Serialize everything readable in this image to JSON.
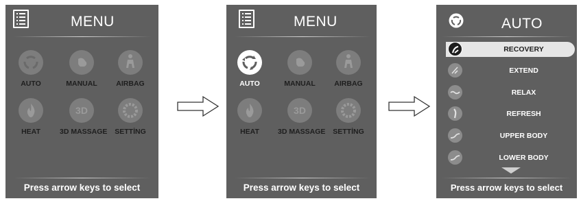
{
  "screens": [
    {
      "title": "MENU",
      "items": [
        {
          "label": "AUTO",
          "icon": "auto-cycle-icon"
        },
        {
          "label": "MANUAL",
          "icon": "hand-icon"
        },
        {
          "label": "AIRBAG",
          "icon": "body-airbag-icon"
        },
        {
          "label": "HEAT",
          "icon": "flame-icon"
        },
        {
          "label": "3D MASSAGE",
          "icon": "3d-icon"
        },
        {
          "label": "SETTİNG",
          "icon": "gear-icon"
        }
      ],
      "selected": null,
      "footer": "Press arrow keys to select"
    },
    {
      "title": "MENU",
      "items": [
        {
          "label": "AUTO",
          "icon": "auto-cycle-icon"
        },
        {
          "label": "MANUAL",
          "icon": "hand-icon"
        },
        {
          "label": "AIRBAG",
          "icon": "body-airbag-icon"
        },
        {
          "label": "HEAT",
          "icon": "flame-icon"
        },
        {
          "label": "3D MASSAGE",
          "icon": "3d-icon"
        },
        {
          "label": "SETTİNG",
          "icon": "gear-icon"
        }
      ],
      "selected": "AUTO",
      "footer": "Press arrow keys to select"
    },
    {
      "title": "AUTO",
      "programs": [
        {
          "label": "RECOVERY",
          "icon": "recovery-icon"
        },
        {
          "label": "EXTEND",
          "icon": "extend-icon"
        },
        {
          "label": "RELAX",
          "icon": "relax-icon"
        },
        {
          "label": "REFRESH",
          "icon": "refresh-icon"
        },
        {
          "label": "UPPER BODY",
          "icon": "upper-body-icon"
        },
        {
          "label": "LOWER BODY",
          "icon": "lower-body-icon"
        }
      ],
      "selected": "RECOVERY",
      "footer": "Press arrow keys to select"
    }
  ],
  "colors": {
    "panel": "#5f5f5f",
    "icon_inactive": "#7d7d7d",
    "label_dark": "#1e1e1e",
    "highlight": "#e6e6e6"
  }
}
